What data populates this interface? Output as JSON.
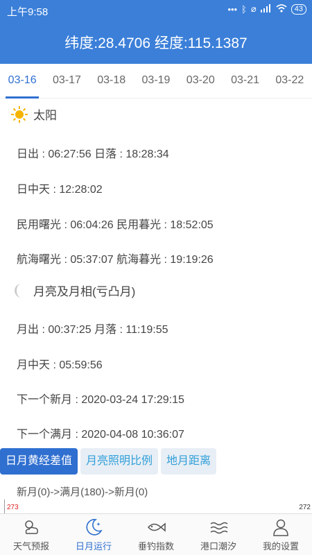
{
  "statusbar": {
    "time": "上午9:58",
    "icons": [
      "more-dots-icon",
      "bluetooth-icon",
      "alarm-icon",
      "signal-icon",
      "wifi-icon"
    ],
    "battery": "43"
  },
  "header": {
    "title": "纬度:28.4706 经度:115.1387"
  },
  "date_tabs": [
    "03-16",
    "03-17",
    "03-18",
    "03-19",
    "03-20",
    "03-21",
    "03-22"
  ],
  "active_date": "03-16",
  "sun": {
    "title": "太阳",
    "lines": [
      "日出 : 06:27:56 日落 : 18:28:34",
      "日中天 : 12:28:02",
      "民用曙光 : 06:04:26 民用暮光 : 18:52:05",
      "航海曙光 : 05:37:07 航海暮光 : 19:19:26"
    ]
  },
  "moon": {
    "title": "月亮及月相(亏凸月)",
    "lines": [
      "月出 : 00:37:25 月落 : 11:19:55",
      "月中天 : 05:59:56",
      "下一个新月 : 2020-03-24 17:29:15",
      "下一个满月 : 2020-04-08 10:36:07"
    ]
  },
  "chart_tabs": [
    "日月黄经差值",
    "月亮照明比例",
    "地月距离"
  ],
  "chart_caption": "新月(0)->满月(180)->新月(0)",
  "chart_labels": {
    "left": "273",
    "right": "272"
  },
  "colors": {
    "primary": "#3b7fd9",
    "accent": "#2f6fd0",
    "sun": "#f5b400",
    "moon": "#cccccc",
    "chart_label_left": "#e02020"
  },
  "bottom_nav": [
    {
      "label": "天气预报",
      "icon": "weather-icon"
    },
    {
      "label": "日月运行",
      "icon": "moon-icon"
    },
    {
      "label": "垂钓指数",
      "icon": "fish-icon"
    },
    {
      "label": "港口潮汐",
      "icon": "tide-icon"
    },
    {
      "label": "我的设置",
      "icon": "user-icon"
    }
  ]
}
